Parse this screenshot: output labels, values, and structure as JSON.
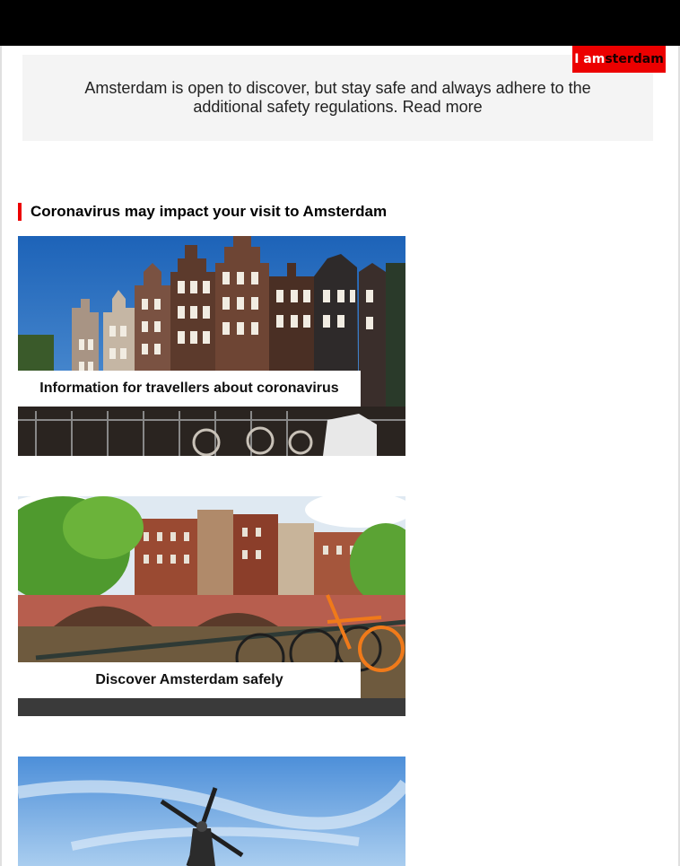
{
  "logo": {
    "part_white": "I am",
    "part_black": "sterdam",
    "color": "#ec0000"
  },
  "notice": {
    "text": "Amsterdam is open to discover, but stay safe and always adhere to the additional safety regulations.",
    "link": "Read more"
  },
  "section": {
    "title": "Coronavirus may impact your visit to Amsterdam"
  },
  "cards": [
    {
      "label": "Information for travellers about coronavirus"
    },
    {
      "label": "Discover Amsterdam safely"
    },
    {
      "label": ""
    }
  ]
}
